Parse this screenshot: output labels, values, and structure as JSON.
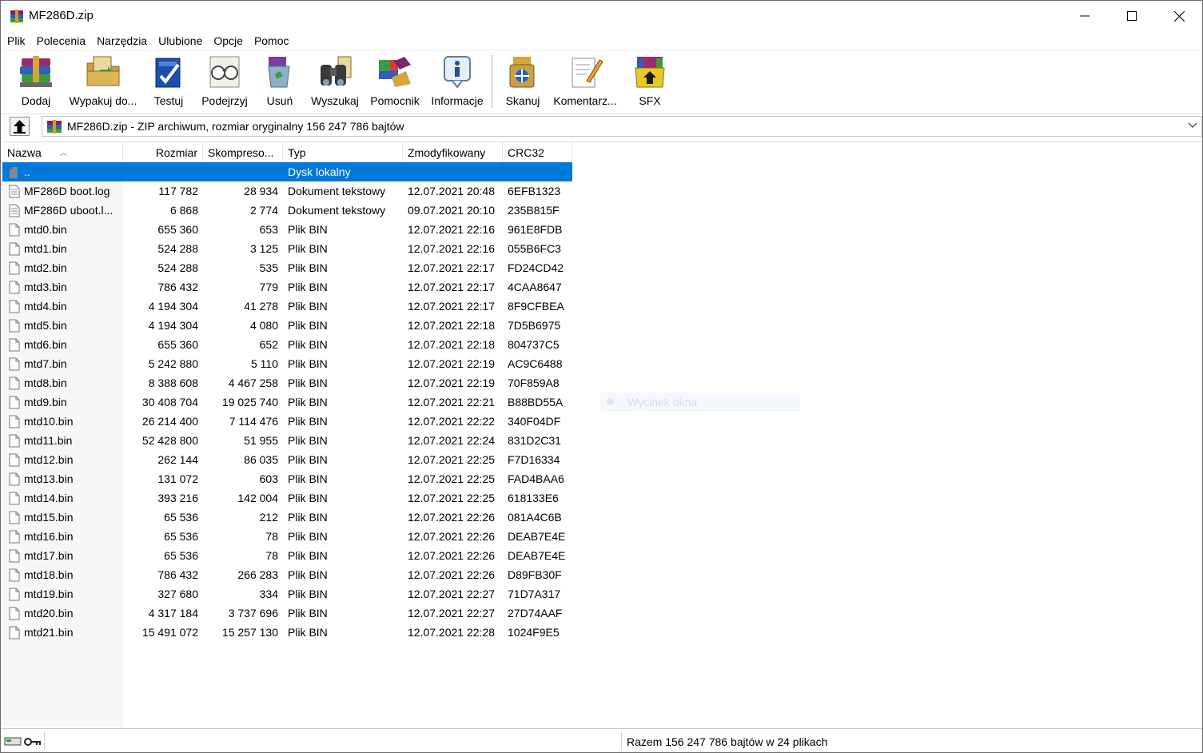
{
  "window": {
    "title": "MF286D.zip"
  },
  "menu": [
    "Plik",
    "Polecenia",
    "Narzędzia",
    "Ulubione",
    "Opcje",
    "Pomoc"
  ],
  "toolbar": {
    "add": "Dodaj",
    "extract": "Wypakuj do...",
    "test": "Testuj",
    "view": "Podejrzyj",
    "delete": "Usuń",
    "find": "Wyszukaj",
    "wizard": "Pomocnik",
    "info": "Informacje",
    "scan": "Skanuj",
    "comment": "Komentarz...",
    "sfx": "SFX"
  },
  "address": {
    "text": "MF286D.zip - ZIP archiwum, rozmiar oryginalny 156 247 786 bajtów"
  },
  "columns": {
    "name": "Nazwa",
    "size": "Rozmiar",
    "compressed": "Skompreso...",
    "type": "Typ",
    "modified": "Zmodyfikowany",
    "crc": "CRC32"
  },
  "rows": [
    {
      "name": "..",
      "size": "",
      "compressed": "",
      "type": "Dysk lokalny",
      "modified": "",
      "crc": ""
    },
    {
      "name": "MF286D boot.log",
      "size": "117 782",
      "compressed": "28 934",
      "type": "Dokument tekstowy",
      "modified": "12.07.2021 20:48",
      "crc": "6EFB1323"
    },
    {
      "name": "MF286D uboot.l...",
      "size": "6 868",
      "compressed": "2 774",
      "type": "Dokument tekstowy",
      "modified": "09.07.2021 20:10",
      "crc": "235B815F"
    },
    {
      "name": "mtd0.bin",
      "size": "655 360",
      "compressed": "653",
      "type": "Plik BIN",
      "modified": "12.07.2021 22:16",
      "crc": "961E8FDB"
    },
    {
      "name": "mtd1.bin",
      "size": "524 288",
      "compressed": "3 125",
      "type": "Plik BIN",
      "modified": "12.07.2021 22:16",
      "crc": "055B6FC3"
    },
    {
      "name": "mtd2.bin",
      "size": "524 288",
      "compressed": "535",
      "type": "Plik BIN",
      "modified": "12.07.2021 22:17",
      "crc": "FD24CD42"
    },
    {
      "name": "mtd3.bin",
      "size": "786 432",
      "compressed": "779",
      "type": "Plik BIN",
      "modified": "12.07.2021 22:17",
      "crc": "4CAA8647"
    },
    {
      "name": "mtd4.bin",
      "size": "4 194 304",
      "compressed": "41 278",
      "type": "Plik BIN",
      "modified": "12.07.2021 22:17",
      "crc": "8F9CFBEA"
    },
    {
      "name": "mtd5.bin",
      "size": "4 194 304",
      "compressed": "4 080",
      "type": "Plik BIN",
      "modified": "12.07.2021 22:18",
      "crc": "7D5B6975"
    },
    {
      "name": "mtd6.bin",
      "size": "655 360",
      "compressed": "652",
      "type": "Plik BIN",
      "modified": "12.07.2021 22:18",
      "crc": "804737C5"
    },
    {
      "name": "mtd7.bin",
      "size": "5 242 880",
      "compressed": "5 110",
      "type": "Plik BIN",
      "modified": "12.07.2021 22:19",
      "crc": "AC9C6488"
    },
    {
      "name": "mtd8.bin",
      "size": "8 388 608",
      "compressed": "4 467 258",
      "type": "Plik BIN",
      "modified": "12.07.2021 22:19",
      "crc": "70F859A8"
    },
    {
      "name": "mtd9.bin",
      "size": "30 408 704",
      "compressed": "19 025 740",
      "type": "Plik BIN",
      "modified": "12.07.2021 22:21",
      "crc": "B88BD55A"
    },
    {
      "name": "mtd10.bin",
      "size": "26 214 400",
      "compressed": "7 114 476",
      "type": "Plik BIN",
      "modified": "12.07.2021 22:22",
      "crc": "340F04DF"
    },
    {
      "name": "mtd11.bin",
      "size": "52 428 800",
      "compressed": "51 955",
      "type": "Plik BIN",
      "modified": "12.07.2021 22:24",
      "crc": "831D2C31"
    },
    {
      "name": "mtd12.bin",
      "size": "262 144",
      "compressed": "86 035",
      "type": "Plik BIN",
      "modified": "12.07.2021 22:25",
      "crc": "F7D16334"
    },
    {
      "name": "mtd13.bin",
      "size": "131 072",
      "compressed": "603",
      "type": "Plik BIN",
      "modified": "12.07.2021 22:25",
      "crc": "FAD4BAA6"
    },
    {
      "name": "mtd14.bin",
      "size": "393 216",
      "compressed": "142 004",
      "type": "Plik BIN",
      "modified": "12.07.2021 22:25",
      "crc": "618133E6"
    },
    {
      "name": "mtd15.bin",
      "size": "65 536",
      "compressed": "212",
      "type": "Plik BIN",
      "modified": "12.07.2021 22:26",
      "crc": "081A4C6B"
    },
    {
      "name": "mtd16.bin",
      "size": "65 536",
      "compressed": "78",
      "type": "Plik BIN",
      "modified": "12.07.2021 22:26",
      "crc": "DEAB7E4E"
    },
    {
      "name": "mtd17.bin",
      "size": "65 536",
      "compressed": "78",
      "type": "Plik BIN",
      "modified": "12.07.2021 22:26",
      "crc": "DEAB7E4E"
    },
    {
      "name": "mtd18.bin",
      "size": "786 432",
      "compressed": "266 283",
      "type": "Plik BIN",
      "modified": "12.07.2021 22:26",
      "crc": "D89FB30F"
    },
    {
      "name": "mtd19.bin",
      "size": "327 680",
      "compressed": "334",
      "type": "Plik BIN",
      "modified": "12.07.2021 22:27",
      "crc": "71D7A317"
    },
    {
      "name": "mtd20.bin",
      "size": "4 317 184",
      "compressed": "3 737 696",
      "type": "Plik BIN",
      "modified": "12.07.2021 22:27",
      "crc": "27D74AAF"
    },
    {
      "name": "mtd21.bin",
      "size": "15 491 072",
      "compressed": "15 257 130",
      "type": "Plik BIN",
      "modified": "12.07.2021 22:28",
      "crc": "1024F9E5"
    }
  ],
  "ghost": {
    "label": "Wycinek okna"
  },
  "status": {
    "text": "Razem 156 247 786 bajtów w 24 plikach"
  },
  "colors": {
    "selection": "#0078d7"
  }
}
